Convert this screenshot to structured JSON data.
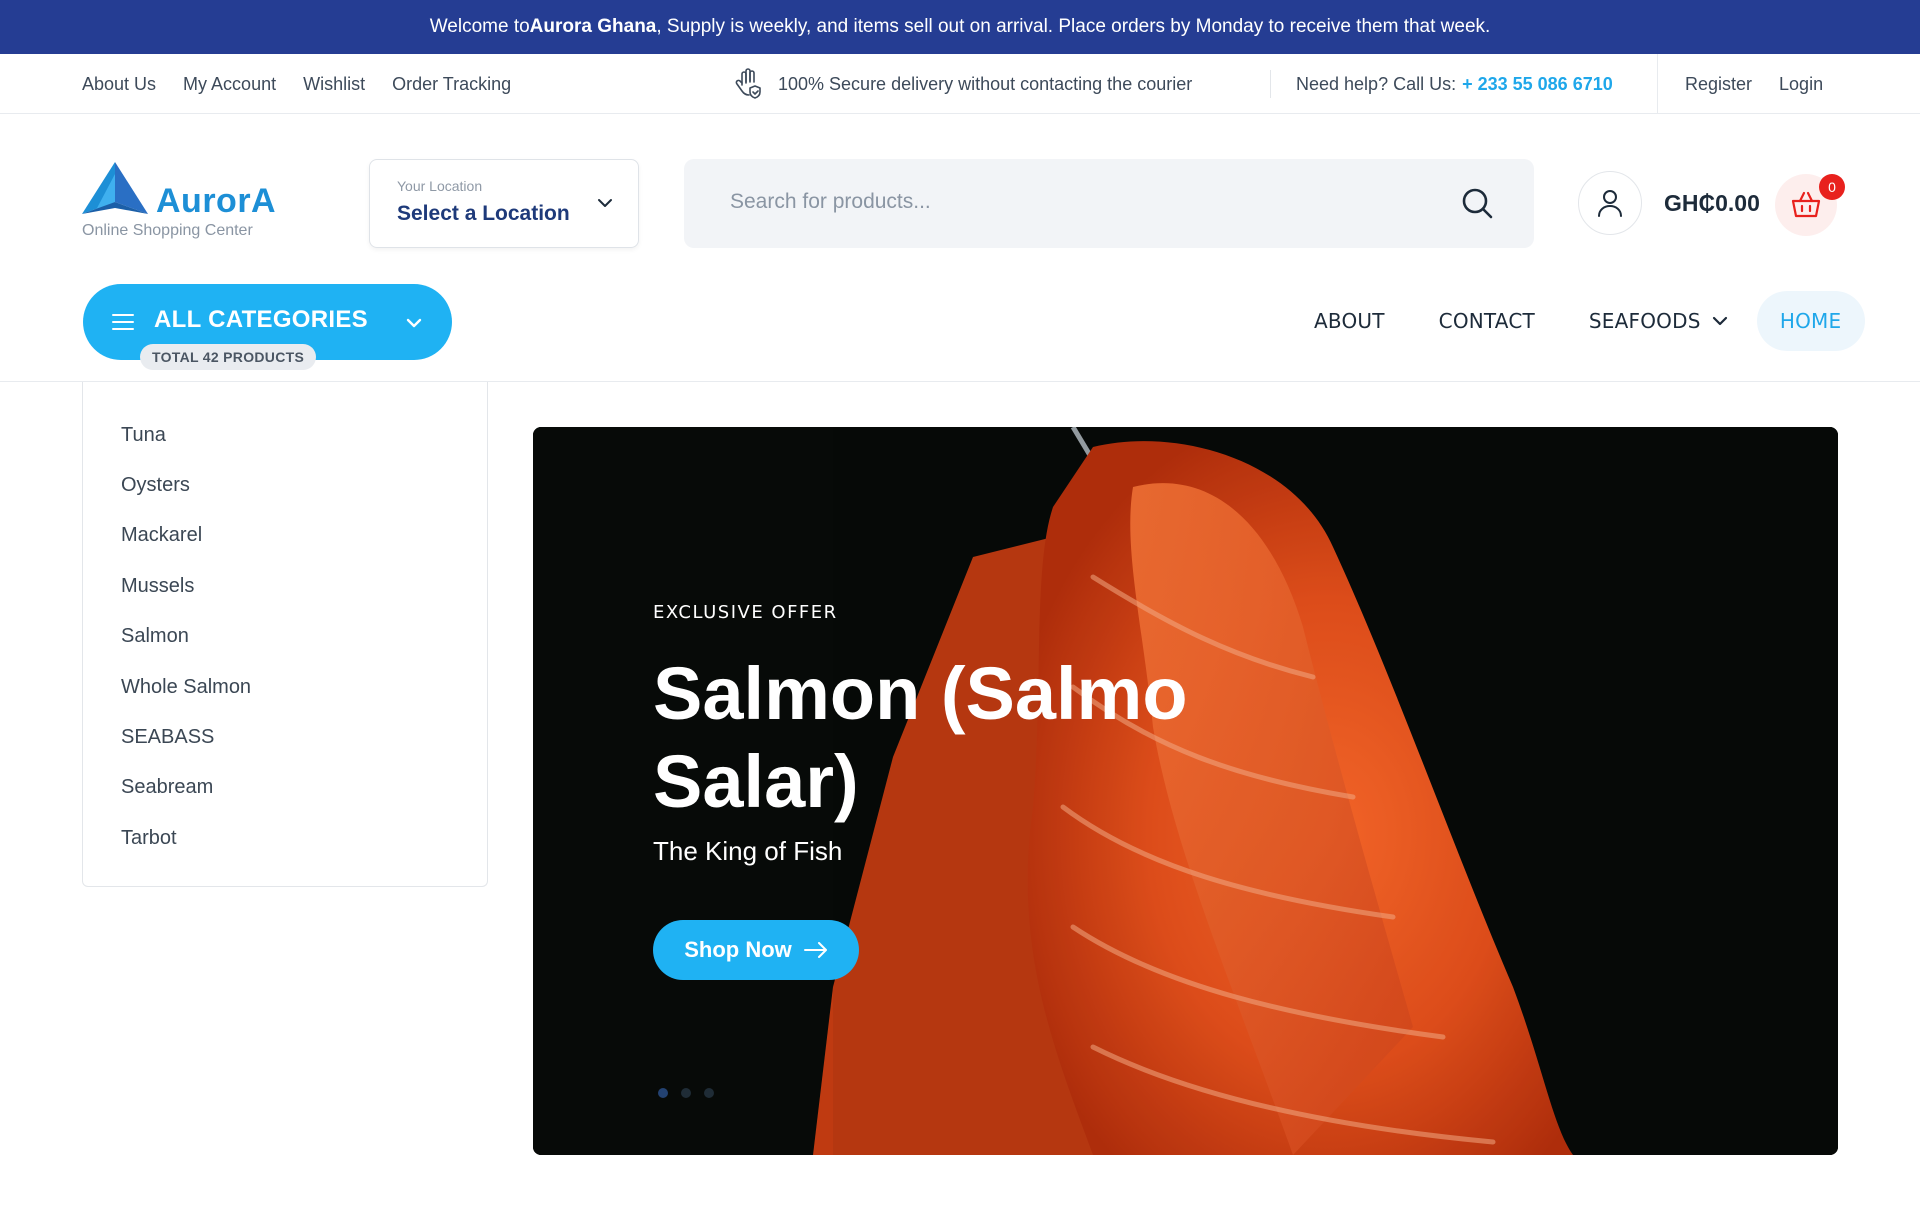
{
  "announcement": {
    "prefix": "Welcome to ",
    "brand": "Aurora Ghana",
    "suffix": ", Supply is weekly, and items sell out on arrival. Place orders by Monday to receive them that week."
  },
  "topbar": {
    "links": [
      "About Us",
      "My Account",
      "Wishlist",
      "Order Tracking"
    ],
    "secure_text": "100% Secure delivery without contacting the courier",
    "help_label": "Need help? Call Us:",
    "phone": "+ 233 55 086 6710",
    "register": "Register",
    "login": "Login"
  },
  "header": {
    "logo_brand": "AurorA",
    "logo_tagline": "Online Shopping Center",
    "location_label": "Your Location",
    "location_value": "Select a Location",
    "search_placeholder": "Search for products...",
    "cart_total": "GH₵0.00",
    "cart_count": "0"
  },
  "nav": {
    "categories_label": "ALL CATEGORIES",
    "total_products": "TOTAL 42 PRODUCTS",
    "items": [
      "ABOUT",
      "CONTACT",
      "SEAFOODS",
      "HOME"
    ]
  },
  "sidebar": {
    "categories": [
      "Tuna",
      "Oysters",
      "Mackarel",
      "Mussels",
      "Salmon",
      "Whole Salmon",
      "SEABASS",
      "Seabream",
      "Tarbot"
    ]
  },
  "hero": {
    "eyebrow": "EXCLUSIVE OFFER",
    "title": "Salmon (Salmo Salar)",
    "subtitle": "The King of Fish",
    "button": "Shop Now",
    "slide_count": 3,
    "active_slide": 1
  },
  "colors": {
    "announcement_bg": "#253d93",
    "accent": "#1fb2f3",
    "phone": "#1fa7ea",
    "badge": "#e8211d"
  }
}
